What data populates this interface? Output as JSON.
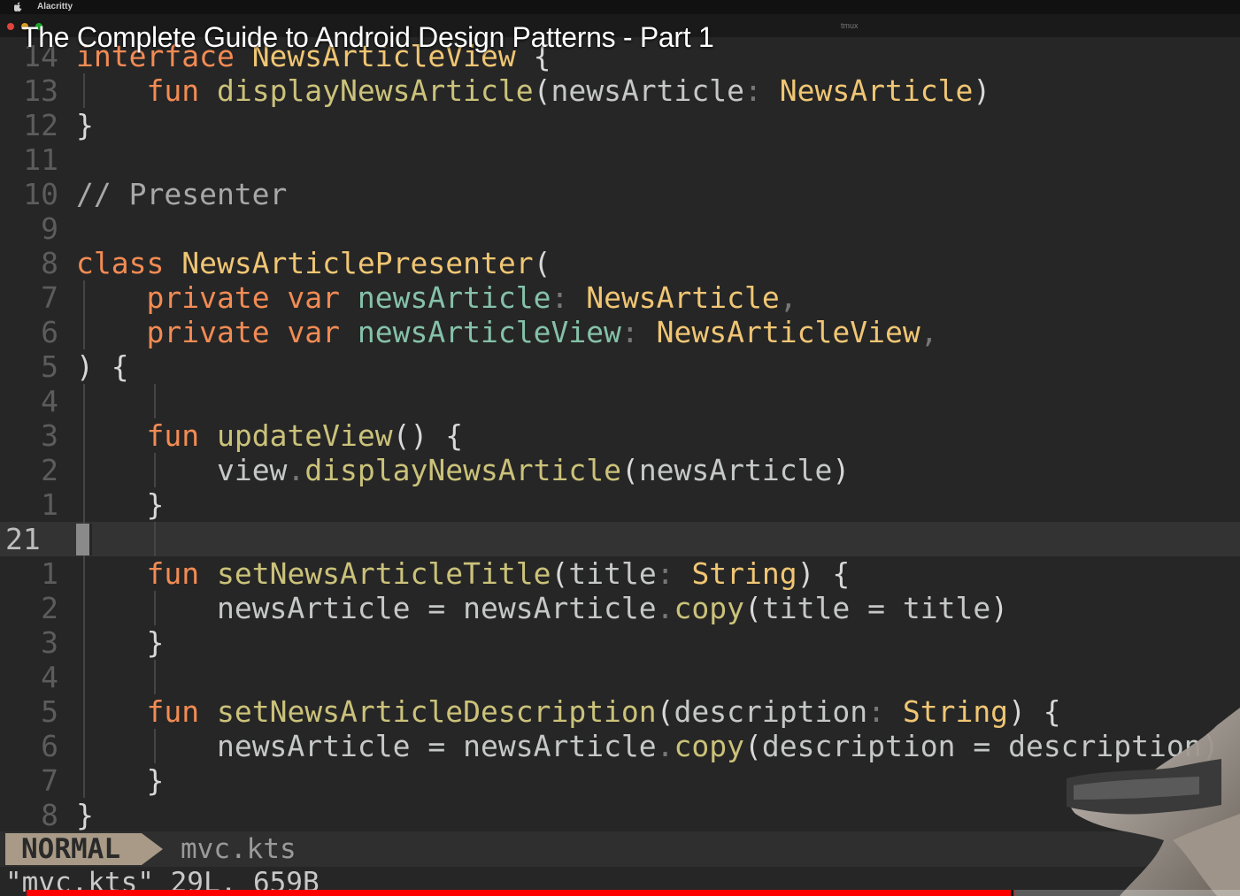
{
  "menubar": {
    "app_name": "Alacritty"
  },
  "window": {
    "tmux_label": "tmux"
  },
  "video": {
    "title": "The Complete Guide to Android Design Patterns - Part 1",
    "progress_fraction": 0.814
  },
  "editor": {
    "lines": [
      {
        "num": "14",
        "segments": [
          [
            "kw",
            "interface"
          ],
          [
            "pu",
            " "
          ],
          [
            "ty",
            "NewsArticleView"
          ],
          [
            "pu",
            " {"
          ]
        ]
      },
      {
        "num": "13",
        "segments": [
          [
            "pu",
            "    "
          ],
          [
            "kw",
            "fun"
          ],
          [
            "pu",
            " "
          ],
          [
            "fn",
            "displayNewsArticle"
          ],
          [
            "pu",
            "("
          ],
          [
            "id",
            "newsArticle"
          ],
          [
            "dim",
            ":"
          ],
          [
            "pu",
            " "
          ],
          [
            "ty",
            "NewsArticle"
          ],
          [
            "pu",
            ")"
          ]
        ]
      },
      {
        "num": "12",
        "segments": [
          [
            "pu",
            "}"
          ]
        ]
      },
      {
        "num": "11",
        "segments": []
      },
      {
        "num": "10",
        "segments": [
          [
            "cm",
            "// Presenter"
          ]
        ]
      },
      {
        "num": "9",
        "segments": []
      },
      {
        "num": "8",
        "segments": [
          [
            "kw",
            "class"
          ],
          [
            "pu",
            " "
          ],
          [
            "ty",
            "NewsArticlePresenter"
          ],
          [
            "pu",
            "("
          ]
        ]
      },
      {
        "num": "7",
        "segments": [
          [
            "pu",
            "    "
          ],
          [
            "kw",
            "private var"
          ],
          [
            "pu",
            " "
          ],
          [
            "pr",
            "newsArticle"
          ],
          [
            "dim",
            ":"
          ],
          [
            "pu",
            " "
          ],
          [
            "ty",
            "NewsArticle"
          ],
          [
            "dim",
            ","
          ]
        ]
      },
      {
        "num": "6",
        "segments": [
          [
            "pu",
            "    "
          ],
          [
            "kw",
            "private var"
          ],
          [
            "pu",
            " "
          ],
          [
            "pr",
            "newsArticleView"
          ],
          [
            "dim",
            ":"
          ],
          [
            "pu",
            " "
          ],
          [
            "ty",
            "NewsArticleView"
          ],
          [
            "dim",
            ","
          ]
        ]
      },
      {
        "num": "5",
        "segments": [
          [
            "pu",
            ") {"
          ]
        ]
      },
      {
        "num": "4",
        "segments": []
      },
      {
        "num": "3",
        "segments": [
          [
            "pu",
            "    "
          ],
          [
            "kw",
            "fun"
          ],
          [
            "pu",
            " "
          ],
          [
            "fn",
            "updateView"
          ],
          [
            "pu",
            "() {"
          ]
        ]
      },
      {
        "num": "2",
        "segments": [
          [
            "pu",
            "        "
          ],
          [
            "id",
            "view"
          ],
          [
            "dim",
            "."
          ],
          [
            "fn",
            "displayNewsArticle"
          ],
          [
            "pu",
            "("
          ],
          [
            "id",
            "newsArticle"
          ],
          [
            "pu",
            ")"
          ]
        ]
      },
      {
        "num": "1",
        "segments": [
          [
            "pu",
            "    }"
          ]
        ]
      },
      {
        "num": "21",
        "current": true,
        "segments": []
      },
      {
        "num": "1",
        "segments": [
          [
            "pu",
            "    "
          ],
          [
            "kw",
            "fun"
          ],
          [
            "pu",
            " "
          ],
          [
            "fn",
            "setNewsArticleTitle"
          ],
          [
            "pu",
            "("
          ],
          [
            "id",
            "title"
          ],
          [
            "dim",
            ":"
          ],
          [
            "pu",
            " "
          ],
          [
            "ty",
            "String"
          ],
          [
            "pu",
            ") {"
          ]
        ]
      },
      {
        "num": "2",
        "segments": [
          [
            "pu",
            "        "
          ],
          [
            "id",
            "newsArticle"
          ],
          [
            "pu",
            " "
          ],
          [
            "op",
            "="
          ],
          [
            "pu",
            " "
          ],
          [
            "id",
            "newsArticle"
          ],
          [
            "dim",
            "."
          ],
          [
            "fn",
            "copy"
          ],
          [
            "pu",
            "("
          ],
          [
            "id",
            "title"
          ],
          [
            "pu",
            " "
          ],
          [
            "op",
            "="
          ],
          [
            "pu",
            " "
          ],
          [
            "id",
            "title"
          ],
          [
            "pu",
            ")"
          ]
        ]
      },
      {
        "num": "3",
        "segments": [
          [
            "pu",
            "    }"
          ]
        ]
      },
      {
        "num": "4",
        "segments": []
      },
      {
        "num": "5",
        "segments": [
          [
            "pu",
            "    "
          ],
          [
            "kw",
            "fun"
          ],
          [
            "pu",
            " "
          ],
          [
            "fn",
            "setNewsArticleDescription"
          ],
          [
            "pu",
            "("
          ],
          [
            "id",
            "description"
          ],
          [
            "dim",
            ":"
          ],
          [
            "pu",
            " "
          ],
          [
            "ty",
            "String"
          ],
          [
            "pu",
            ") {"
          ]
        ]
      },
      {
        "num": "6",
        "segments": [
          [
            "pu",
            "        "
          ],
          [
            "id",
            "newsArticle"
          ],
          [
            "pu",
            " "
          ],
          [
            "op",
            "="
          ],
          [
            "pu",
            " "
          ],
          [
            "id",
            "newsArticle"
          ],
          [
            "dim",
            "."
          ],
          [
            "fn",
            "copy"
          ],
          [
            "pu",
            "("
          ],
          [
            "id",
            "description"
          ],
          [
            "pu",
            " "
          ],
          [
            "op",
            "="
          ],
          [
            "pu",
            " "
          ],
          [
            "id",
            "description"
          ],
          [
            "pu",
            ")"
          ]
        ]
      },
      {
        "num": "7",
        "segments": [
          [
            "pu",
            "    }"
          ]
        ]
      },
      {
        "num": "8",
        "segments": [
          [
            "pu",
            "}"
          ]
        ]
      }
    ]
  },
  "statusline": {
    "mode": "NORMAL",
    "filename": "mvc.kts"
  },
  "cmdline": {
    "text": "\"mvc.kts\" 29L, 659B"
  },
  "colors": {
    "keyword": "#f28b54",
    "function": "#cbc27a",
    "type": "#f0c674",
    "property": "#85c1a9",
    "progress": "#ff0000"
  }
}
